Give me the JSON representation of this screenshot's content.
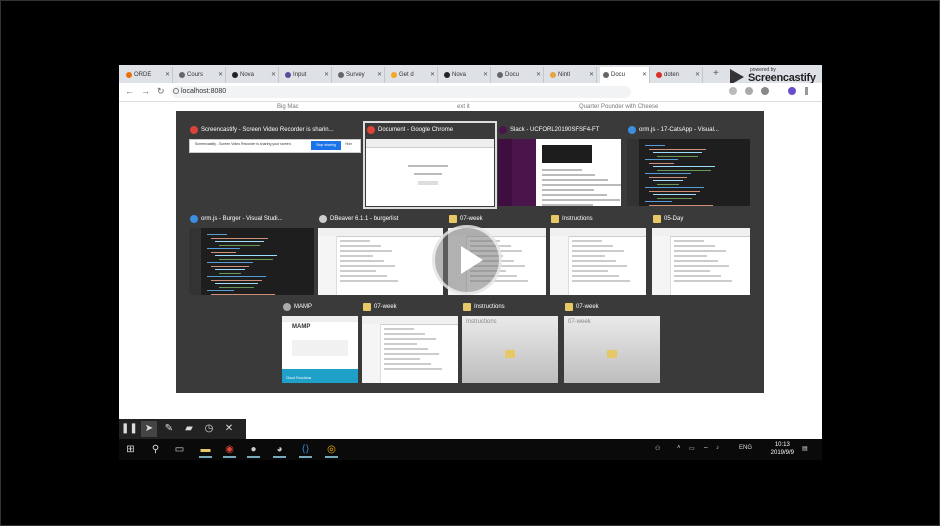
{
  "browser": {
    "tabs": [
      {
        "label": "ORDE",
        "icon_color": "#e8710a"
      },
      {
        "label": "Cours",
        "icon_color": "#666666"
      },
      {
        "label": "Nova",
        "icon_color": "#222222"
      },
      {
        "label": "Input",
        "icon_color": "#5b4aa0"
      },
      {
        "label": "Survey",
        "icon_color": "#666666"
      },
      {
        "label": "Get d",
        "icon_color": "#f5a623"
      },
      {
        "label": "Nova",
        "icon_color": "#222222"
      },
      {
        "label": "Docu",
        "icon_color": "#666666"
      },
      {
        "label": "Nintl",
        "icon_color": "#e8a33d"
      },
      {
        "label": "Docu",
        "icon_color": "#666666"
      },
      {
        "label": "doten",
        "icon_color": "#d93025"
      }
    ],
    "active_tab_index": 9,
    "new_tab_label": "+",
    "url": "localhost:8080",
    "brand_small": "powered by",
    "brand_name": "Screencastify"
  },
  "page_fragments": {
    "left": "Big Mac",
    "middle": "ext it",
    "right": "Quarter Pounder with Cheese"
  },
  "switcher": {
    "windows": [
      {
        "title": "Screencastify - Screen Video Recorder is sharin...",
        "icon": "chrome-icon",
        "kind": "banner",
        "banner_text": "Screencastify - Screen Video Recorder is sharing your screen.",
        "banner_stop": "Stop sharing",
        "banner_hide": "Hide"
      },
      {
        "title": "Document - Google Chrome",
        "icon": "chrome-icon",
        "kind": "doc",
        "selected": true
      },
      {
        "title": "Slack - UCFORL20190SFSF4-FT",
        "icon": "slack-icon",
        "kind": "slack"
      },
      {
        "title": "orm.js - 17-CatsApp - Visual...",
        "icon": "vscode-icon",
        "kind": "code"
      },
      {
        "title": "orm.js - Burger - Visual Studi...",
        "icon": "vscode-icon",
        "kind": "code"
      },
      {
        "title": "DBeaver 6.1.1 - burgerlist",
        "icon": "dbeaver-icon",
        "kind": "explorer"
      },
      {
        "title": "07-week",
        "icon": "folder-icon",
        "kind": "explorer"
      },
      {
        "title": "Instructions",
        "icon": "folder-icon",
        "kind": "explorer"
      },
      {
        "title": "05-Day",
        "icon": "folder-icon",
        "kind": "explorer"
      },
      {
        "title": "MAMP",
        "icon": "mamp-icon",
        "kind": "mamp",
        "mamp_label": "MAMP",
        "mamp_cloud": "Cloud Functions"
      },
      {
        "title": "07-week",
        "icon": "folder-icon",
        "kind": "explorer"
      },
      {
        "title": "Instructions",
        "icon": "folder-icon",
        "kind": "minimized",
        "inner_label": "Instructions"
      },
      {
        "title": "07-week",
        "icon": "folder-icon",
        "kind": "minimized",
        "inner_label": "07-week"
      }
    ]
  },
  "taskbar": {
    "language": "ENG",
    "time": "10:13",
    "date": "2019/9/9"
  }
}
